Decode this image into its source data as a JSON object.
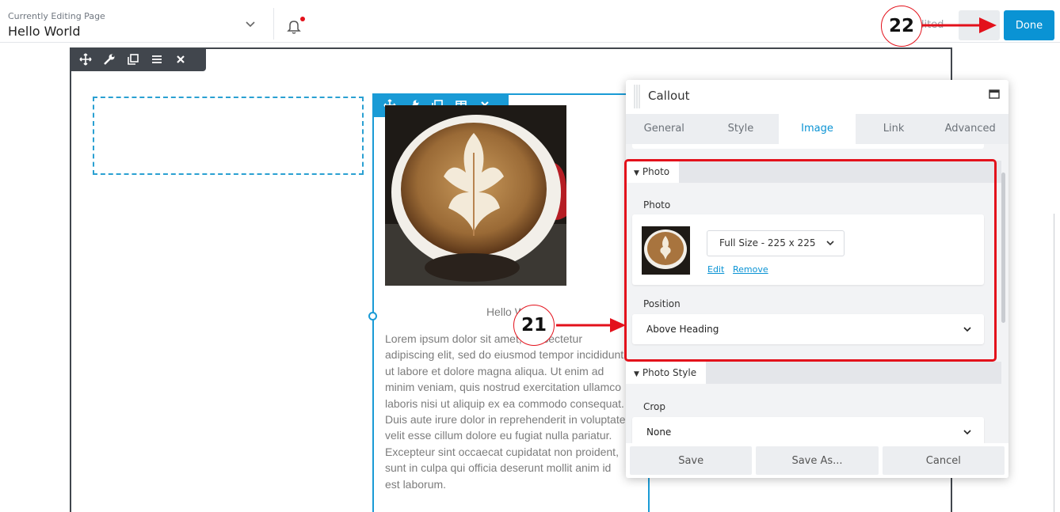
{
  "header": {
    "editing_label": "Currently Editing Page",
    "page_name": "Hello World",
    "status_text": "Edited",
    "done_label": "Done"
  },
  "module": {
    "heading": "Hello World",
    "body": "Lorem ipsum dolor sit amet, consectetur adipiscing elit, sed do eiusmod tempor incididunt ut labore et dolore magna aliqua. Ut enim ad minim veniam, quis nostrud exercitation ullamco laboris nisi ut aliquip ex ea commodo consequat. Duis aute irure dolor in reprehenderit in voluptate velit esse cillum dolore eu fugiat nulla pariatur. Excepteur sint occaecat cupidatat non proident, sunt in culpa qui officia deserunt mollit anim id est laborum."
  },
  "panel": {
    "title": "Callout",
    "tabs": [
      {
        "label": "General"
      },
      {
        "label": "Style"
      },
      {
        "label": "Image"
      },
      {
        "label": "Link"
      },
      {
        "label": "Advanced"
      }
    ],
    "photo_section": {
      "title": "Photo",
      "photo_label": "Photo",
      "size_select": "Full Size - 225 x 225",
      "edit_link": "Edit",
      "remove_link": "Remove",
      "position_label": "Position",
      "position_value": "Above Heading"
    },
    "photo_style_section": {
      "title": "Photo Style",
      "crop_label": "Crop",
      "crop_value": "None"
    },
    "footer": {
      "save": "Save",
      "save_as": "Save As...",
      "cancel": "Cancel"
    }
  },
  "annotations": {
    "step_21": "21",
    "step_22": "22"
  },
  "colors": {
    "accent": "#0a93d4",
    "annotation_red": "#e3111b",
    "row_toolbar": "#41464d"
  }
}
